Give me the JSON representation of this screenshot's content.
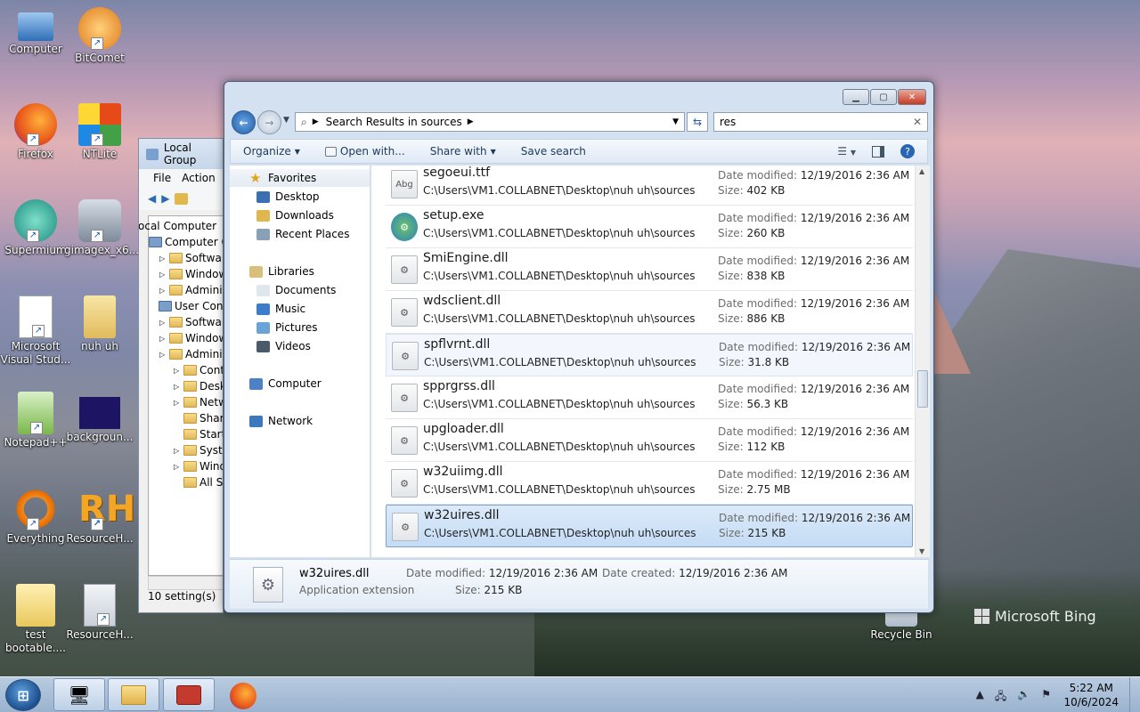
{
  "desktop_icons": [
    {
      "label": "Computer",
      "icon": "computer-icon"
    },
    {
      "label": "BitComet",
      "icon": "bitcomet-icon"
    },
    {
      "label": "Firefox",
      "icon": "firefox-icon"
    },
    {
      "label": "NTLite",
      "icon": "ntlite-icon"
    },
    {
      "label": "Supermium",
      "icon": "supermium-icon"
    },
    {
      "label": "gimagex_x6...",
      "icon": "gimagex-icon"
    },
    {
      "label": "Microsoft Visual Stud...",
      "icon": "visual-studio-icon"
    },
    {
      "label": "nuh uh",
      "icon": "folder-icon"
    },
    {
      "label": "Notepad++",
      "icon": "notepad-plus-plus-icon"
    },
    {
      "label": "backgroun...",
      "icon": "image-file-icon"
    },
    {
      "label": "Everything",
      "icon": "everything-icon"
    },
    {
      "label": "ResourceH...",
      "icon": "resource-hacker-icon"
    },
    {
      "label": "test bootable....",
      "icon": "word-document-icon"
    },
    {
      "label": "ResourceH...",
      "icon": "gear-file-icon"
    },
    {
      "label": "Recycle Bin",
      "icon": "recycle-bin-icon"
    }
  ],
  "bing": "Microsoft Bing",
  "gpedit": {
    "title": "Local Group",
    "menu": [
      "File",
      "Action"
    ],
    "tree": [
      "ocal Computer",
      "Computer Co",
      "Software",
      "Windows",
      "Administ",
      "User Configu",
      "Software",
      "Windows",
      "Administ",
      "Contr",
      "Deskto",
      "Netwo",
      "Share",
      "Start M",
      "Syster",
      "Windo",
      "All Se"
    ],
    "status": "10 setting(s)"
  },
  "explorer": {
    "address": "Search Results in sources",
    "search": "res",
    "toolbar": {
      "organize": "Organize",
      "open_with": "Open with...",
      "share_with": "Share with",
      "save_search": "Save search"
    },
    "nav": {
      "favorites": "Favorites",
      "fav_items": [
        "Desktop",
        "Downloads",
        "Recent Places"
      ],
      "libraries": "Libraries",
      "lib_items": [
        "Documents",
        "Music",
        "Pictures",
        "Videos"
      ],
      "computer": "Computer",
      "network": "Network"
    },
    "labels": {
      "date_modified": "Date modified:",
      "size": "Size:"
    },
    "files": [
      {
        "name": "segoeui.ttf",
        "path": "C:\\Users\\VM1.COLLABNET\\Desktop\\nuh uh\\sources",
        "date": "12/19/2016 2:36 AM",
        "size": "402 KB",
        "icon": "font-file-icon",
        "icon_text": "Abg"
      },
      {
        "name": "setup.exe",
        "path": "C:\\Users\\VM1.COLLABNET\\Desktop\\nuh uh\\sources",
        "date": "12/19/2016 2:36 AM",
        "size": "260 KB",
        "icon": "setup-exe-icon",
        "icon_text": "⚙"
      },
      {
        "name": "SmiEngine.dll",
        "path": "C:\\Users\\VM1.COLLABNET\\Desktop\\nuh uh\\sources",
        "date": "12/19/2016 2:36 AM",
        "size": "838 KB",
        "icon": "dll-file-icon",
        "icon_text": "⚙"
      },
      {
        "name": "wdsclient.dll",
        "path": "C:\\Users\\VM1.COLLABNET\\Desktop\\nuh uh\\sources",
        "date": "12/19/2016 2:36 AM",
        "size": "886 KB",
        "icon": "dll-file-icon",
        "icon_text": "⚙"
      },
      {
        "name": "spflvrnt.dll",
        "path": "C:\\Users\\VM1.COLLABNET\\Desktop\\nuh uh\\sources",
        "date": "12/19/2016 2:36 AM",
        "size": "31.8 KB",
        "icon": "dll-file-icon",
        "icon_text": "⚙"
      },
      {
        "name": "spprgrss.dll",
        "path": "C:\\Users\\VM1.COLLABNET\\Desktop\\nuh uh\\sources",
        "date": "12/19/2016 2:36 AM",
        "size": "56.3 KB",
        "icon": "dll-file-icon",
        "icon_text": "⚙"
      },
      {
        "name": "upgloader.dll",
        "path": "C:\\Users\\VM1.COLLABNET\\Desktop\\nuh uh\\sources",
        "date": "12/19/2016 2:36 AM",
        "size": "112 KB",
        "icon": "dll-file-icon",
        "icon_text": "⚙"
      },
      {
        "name": "w32uiimg.dll",
        "path": "C:\\Users\\VM1.COLLABNET\\Desktop\\nuh uh\\sources",
        "date": "12/19/2016 2:36 AM",
        "size": "2.75 MB",
        "icon": "dll-file-icon",
        "icon_text": "⚙"
      },
      {
        "name": "w32uires.dll",
        "path": "C:\\Users\\VM1.COLLABNET\\Desktop\\nuh uh\\sources",
        "date": "12/19/2016 2:36 AM",
        "size": "215 KB",
        "icon": "dll-file-icon",
        "icon_text": "⚙"
      }
    ],
    "hovered_index": 4,
    "selected_index": 8,
    "details": {
      "name": "w32uires.dll",
      "type": "Application extension",
      "date_modified_label": "Date modified:",
      "date_modified": "12/19/2016 2:36 AM",
      "date_created_label": "Date created:",
      "date_created": "12/19/2016 2:36 AM",
      "size_label": "Size:",
      "size": "215 KB"
    }
  },
  "taskbar": {
    "time": "5:22 AM",
    "date": "10/6/2024"
  }
}
